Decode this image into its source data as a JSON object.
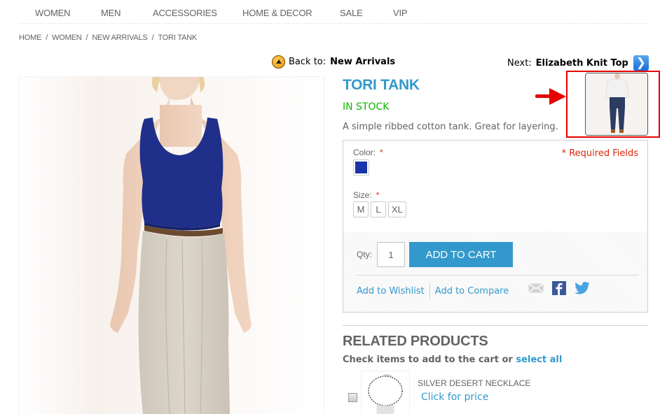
{
  "nav": {
    "items": [
      "WOMEN",
      "MEN",
      "ACCESSORIES",
      "HOME & DECOR",
      "SALE",
      "VIP"
    ]
  },
  "breadcrumb": {
    "items": [
      "HOME",
      "WOMEN",
      "NEW ARRIVALS",
      "TORI TANK"
    ],
    "separator": "/"
  },
  "prev_next": {
    "back_prefix": "Back to:",
    "back_target": "New Arrivals",
    "next_prefix": "Next:",
    "next_target": "Elizabeth Knit Top"
  },
  "product": {
    "name": "TORI TANK",
    "availability": "IN STOCK",
    "description": "A simple ribbed cotton tank. Great for layering.",
    "main_image_alt": "Model wearing navy blue tank top with beige trousers",
    "next_thumb_alt": "Elizabeth Knit Top thumbnail"
  },
  "options": {
    "color_label": "Color:",
    "required_star": "*",
    "required_fields": "* Required Fields",
    "color_swatches": [
      {
        "name": "Blue",
        "hex": "#1a33a8"
      }
    ],
    "size_label": "Size:",
    "sizes": [
      "M",
      "L",
      "XL"
    ]
  },
  "cart": {
    "qty_label": "Qty:",
    "qty_value": "1",
    "add_to_cart": "ADD TO CART",
    "wishlist": "Add to Wishlist",
    "compare": "Add to Compare"
  },
  "related": {
    "title": "RELATED PRODUCTS",
    "note_prefix": "Check items to add to the cart or",
    "select_all": "select all",
    "items": [
      {
        "name": "SILVER DESERT NECKLACE",
        "price_link": "Click for price"
      }
    ]
  },
  "colors": {
    "accent": "#3399cc",
    "in_stock": "#11b400",
    "required": "#df280a",
    "annotation": "#e60000"
  }
}
